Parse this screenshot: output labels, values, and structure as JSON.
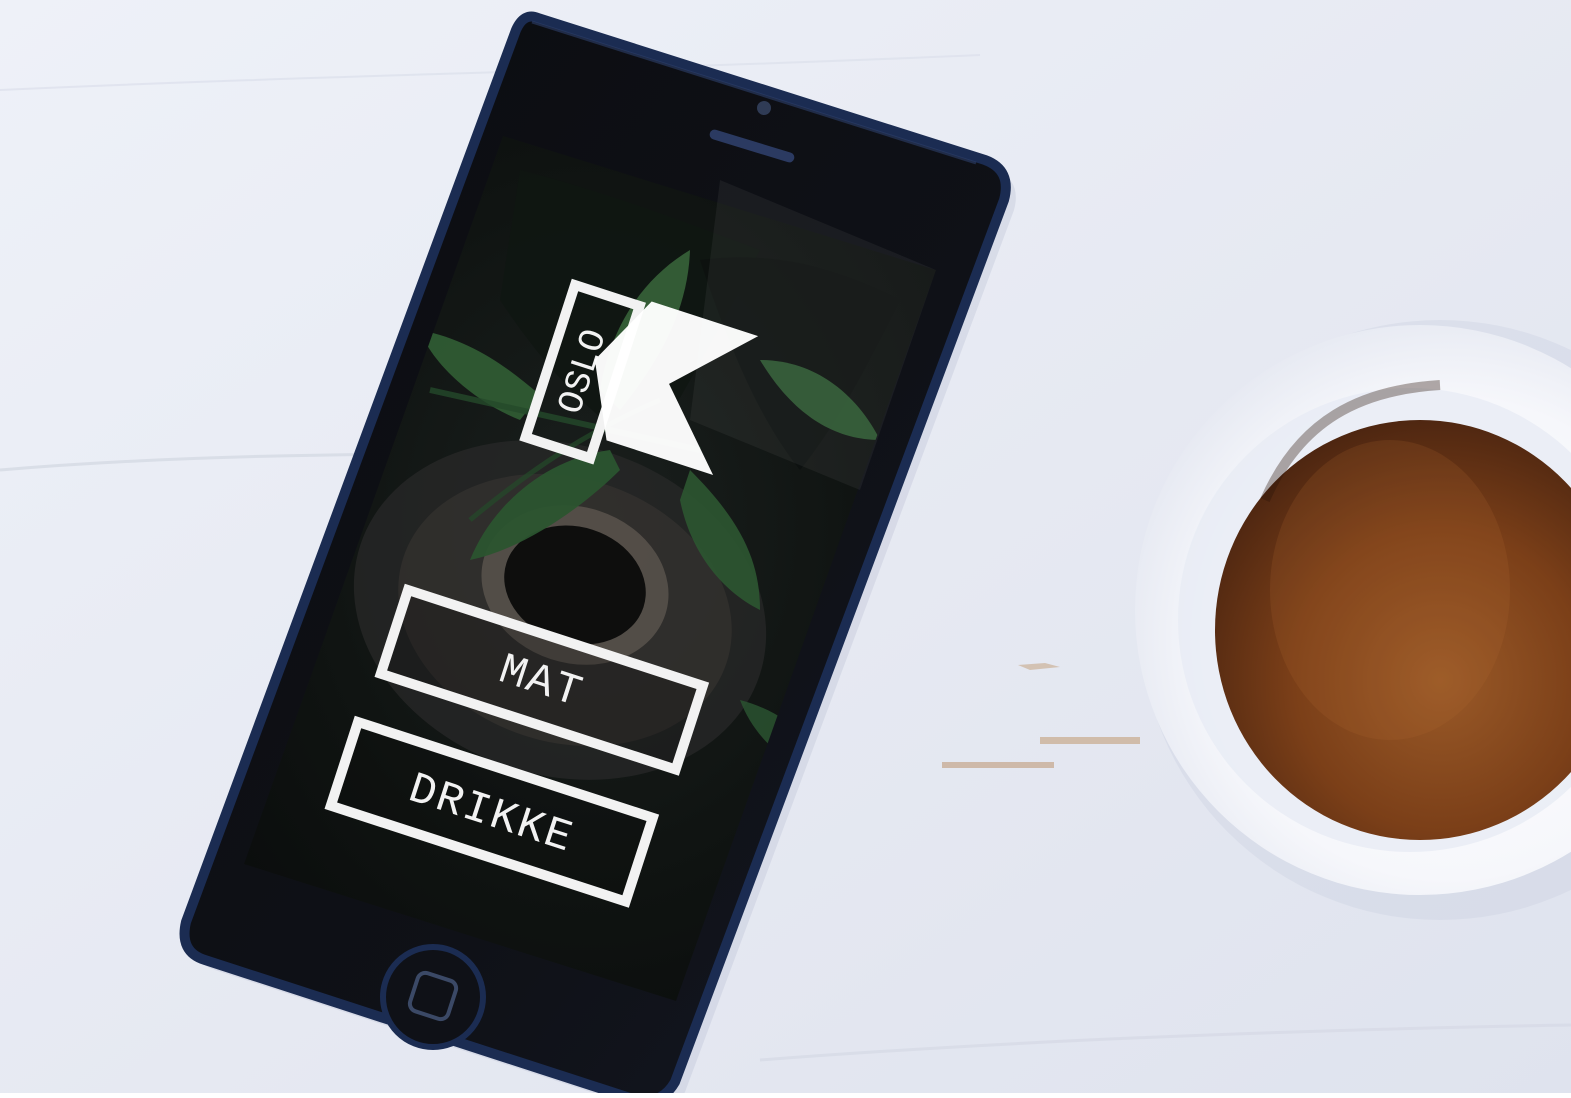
{
  "app": {
    "logo_wordmark": "OSLO",
    "buttons": {
      "mat_label": "MAT",
      "drikke_label": "DRIKKE"
    }
  },
  "colors": {
    "table_top": "#e7eaf3",
    "phone_body": "#111318",
    "phone_edge": "#1b2c52",
    "screen_bg": "#0d0f12",
    "leaf_green": "#2f5b33",
    "coffee": "#8a4b1e",
    "cup": "#f7f8fb",
    "button_border": "#f2f2f2"
  },
  "icons": {
    "home_button": "home-button-square-icon",
    "logo_k": "k-logo-icon"
  }
}
